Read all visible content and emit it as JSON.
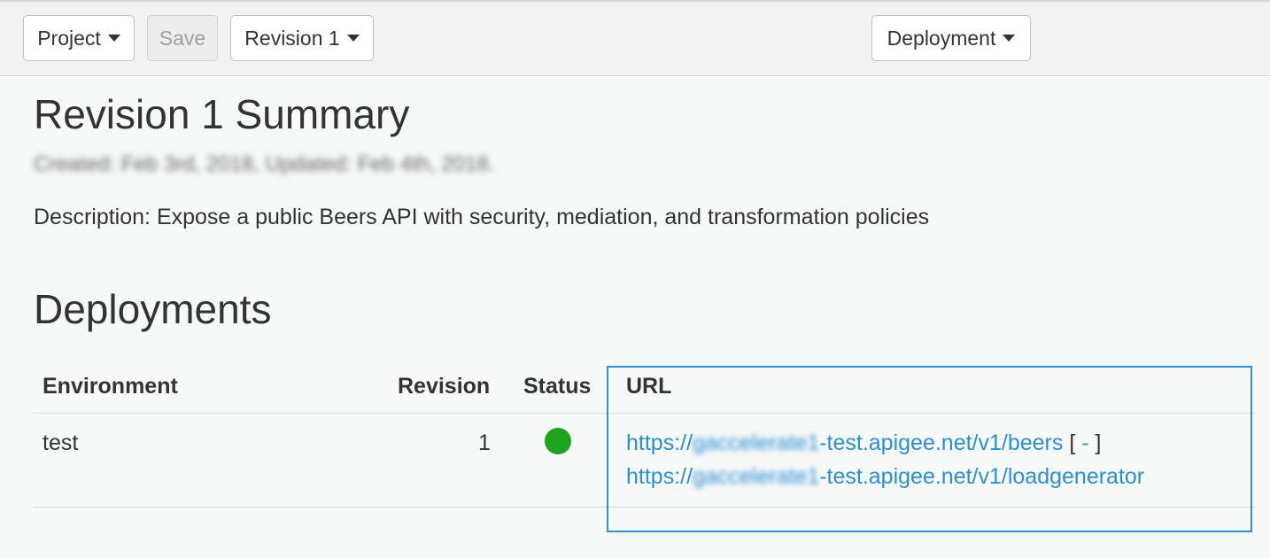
{
  "toolbar": {
    "project_label": "Project",
    "save_label": "Save",
    "revision_label": "Revision 1",
    "deployment_label": "Deployment"
  },
  "summary": {
    "title": "Revision 1 Summary",
    "meta": "Created: Feb 3rd, 2018, Updated: Feb 4th, 2018.",
    "description": "Description: Expose a public Beers API with security, mediation, and transformation policies"
  },
  "deployments": {
    "heading": "Deployments",
    "columns": {
      "environment": "Environment",
      "revision": "Revision",
      "status": "Status",
      "url": "URL"
    },
    "rows": [
      {
        "environment": "test",
        "revision": "1",
        "status_color": "#1ea51e",
        "urls": [
          {
            "prefix": "https://",
            "org": "gaccelerate1",
            "suffix": "-test.apigee.net/v1/beers",
            "action_open": "[",
            "action": "-",
            "action_close": "]"
          },
          {
            "prefix": "https://",
            "org": "gaccelerate1",
            "suffix": "-test.apigee.net/v1/loadgenerator"
          }
        ]
      }
    ]
  }
}
